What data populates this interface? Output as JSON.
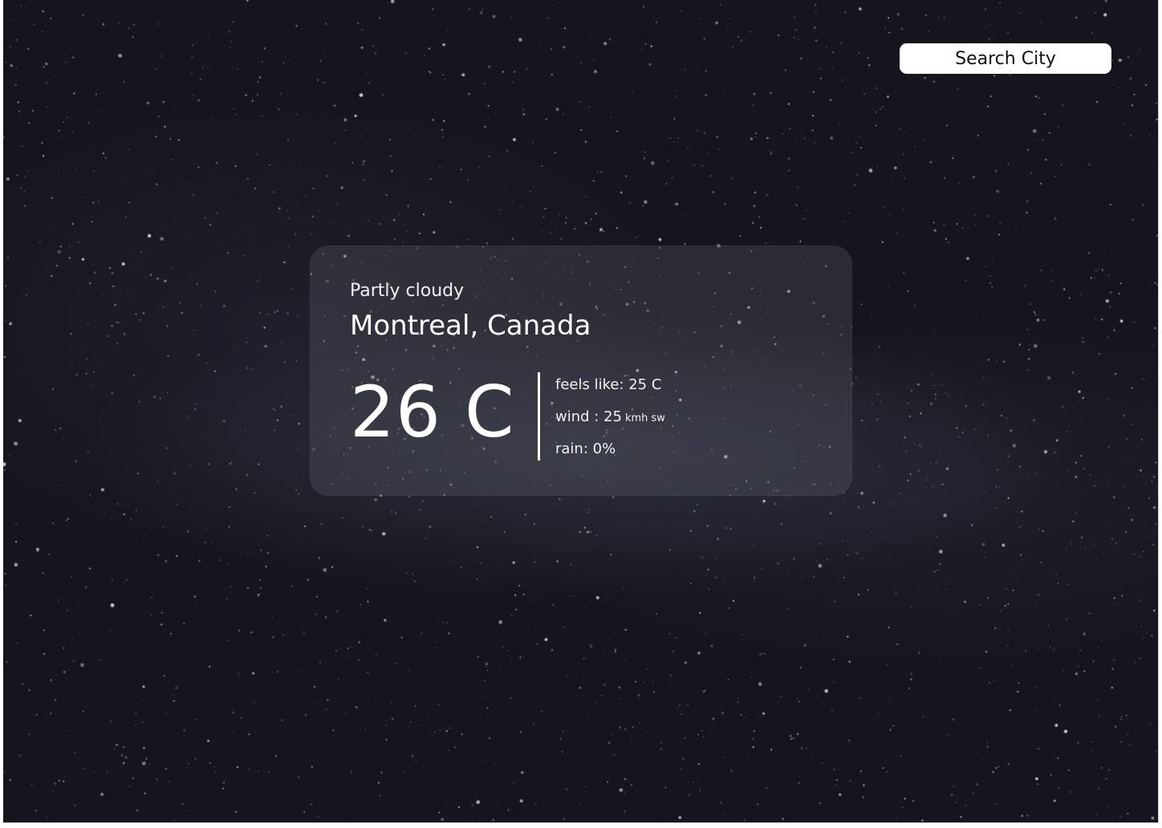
{
  "search": {
    "label": "Search City"
  },
  "weather": {
    "condition": "Partly cloudy",
    "location": "Montreal, Canada",
    "temperature": "26 C",
    "feels_like": "feels like: 25 C",
    "wind_value": "wind : 25",
    "wind_unit": "kmh sw",
    "rain": "rain: 0%"
  },
  "colors": {
    "background": "#15161d",
    "card": "#3a3c46",
    "text": "#ffffff",
    "button": "#ffffff"
  }
}
